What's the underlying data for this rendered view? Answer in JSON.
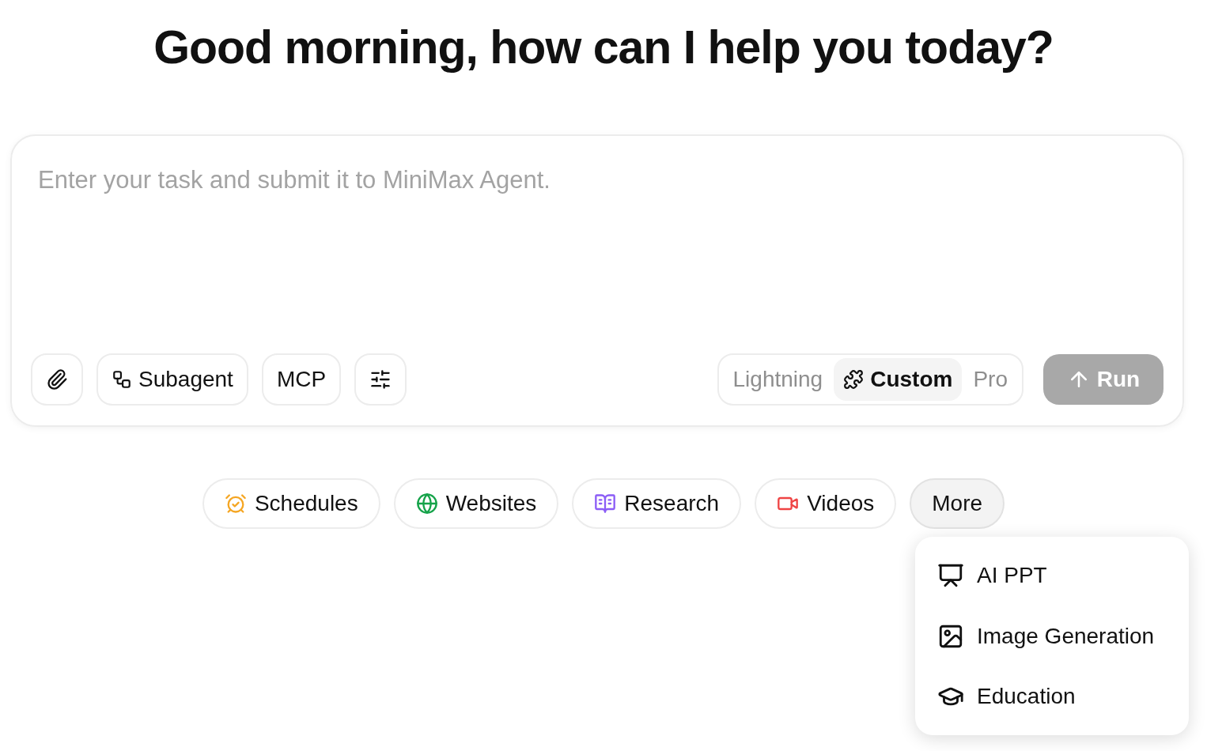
{
  "heading": "Good morning, how can I help you today?",
  "composer": {
    "placeholder": "Enter your task and submit it to MiniMax Agent.",
    "tools": [
      {
        "kind": "attach"
      },
      {
        "kind": "subagent",
        "label": "Subagent"
      },
      {
        "kind": "text",
        "label": "MCP"
      },
      {
        "kind": "settings"
      }
    ],
    "modes": [
      {
        "label": "Lightning",
        "selected": false,
        "kind": "plain"
      },
      {
        "label": "Custom",
        "selected": true,
        "kind": "custom"
      },
      {
        "label": "Pro",
        "selected": false,
        "kind": "plain"
      }
    ],
    "run": {
      "label": "Run",
      "disabled": true
    }
  },
  "chips": [
    {
      "label": "Schedules",
      "kind": "alarm",
      "color": "#f5a623"
    },
    {
      "label": "Websites",
      "kind": "globe",
      "color": "#16a34a"
    },
    {
      "label": "Research",
      "kind": "book",
      "color": "#8b5cf6"
    },
    {
      "label": "Videos",
      "kind": "video",
      "color": "#ef4444"
    },
    {
      "label": "More",
      "kind": "more",
      "expanded": true
    }
  ],
  "more_menu": [
    {
      "label": "AI PPT",
      "kind": "presentation"
    },
    {
      "label": "Image Generation",
      "kind": "image"
    },
    {
      "label": "Education",
      "kind": "education"
    }
  ]
}
